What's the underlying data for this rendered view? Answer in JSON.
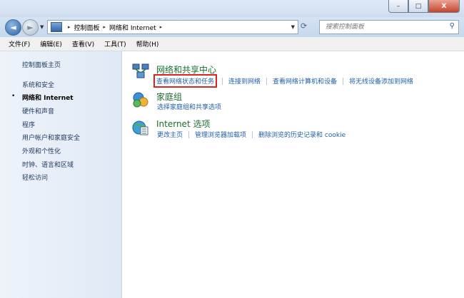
{
  "window": {
    "minimize_glyph": "–",
    "maximize_glyph": "□",
    "close_glyph": "X"
  },
  "address": {
    "back_glyph": "◄",
    "forward_glyph": "►",
    "path": [
      "控制面板",
      "网络和 Internet"
    ],
    "separator": "▸",
    "search_placeholder": "搜索控制面板"
  },
  "menu": [
    "文件(F)",
    "编辑(E)",
    "查看(V)",
    "工具(T)",
    "帮助(H)"
  ],
  "sidebar": {
    "items": [
      {
        "label": "控制面板主页",
        "active": false
      },
      {
        "label": "系统和安全",
        "active": false
      },
      {
        "label": "网络和 Internet",
        "active": true
      },
      {
        "label": "硬件和声音",
        "active": false
      },
      {
        "label": "程序",
        "active": false
      },
      {
        "label": "用户帐户和家庭安全",
        "active": false
      },
      {
        "label": "外观和个性化",
        "active": false
      },
      {
        "label": "时钟、语言和区域",
        "active": false
      },
      {
        "label": "轻松访问",
        "active": false
      }
    ],
    "active_bullet": "•"
  },
  "categories": [
    {
      "title": "网络和共享中心",
      "icon": "network-sharing-icon",
      "links": [
        "查看网络状态和任务",
        "连接到网络",
        "查看网络计算机和设备",
        "将无线设备添加到网络"
      ],
      "highlighted_link": 0
    },
    {
      "title": "家庭组",
      "icon": "homegroup-icon",
      "links": [
        "选择家庭组和共享选项"
      ]
    },
    {
      "title": "Internet 选项",
      "icon": "internet-options-icon",
      "links": [
        "更改主页",
        "管理浏览器加载项",
        "删除浏览的历史记录和 cookie"
      ]
    }
  ],
  "colors": {
    "link": "#1f5fa8",
    "category_title": "#1a6e2e",
    "highlight_border": "#d9251d"
  }
}
